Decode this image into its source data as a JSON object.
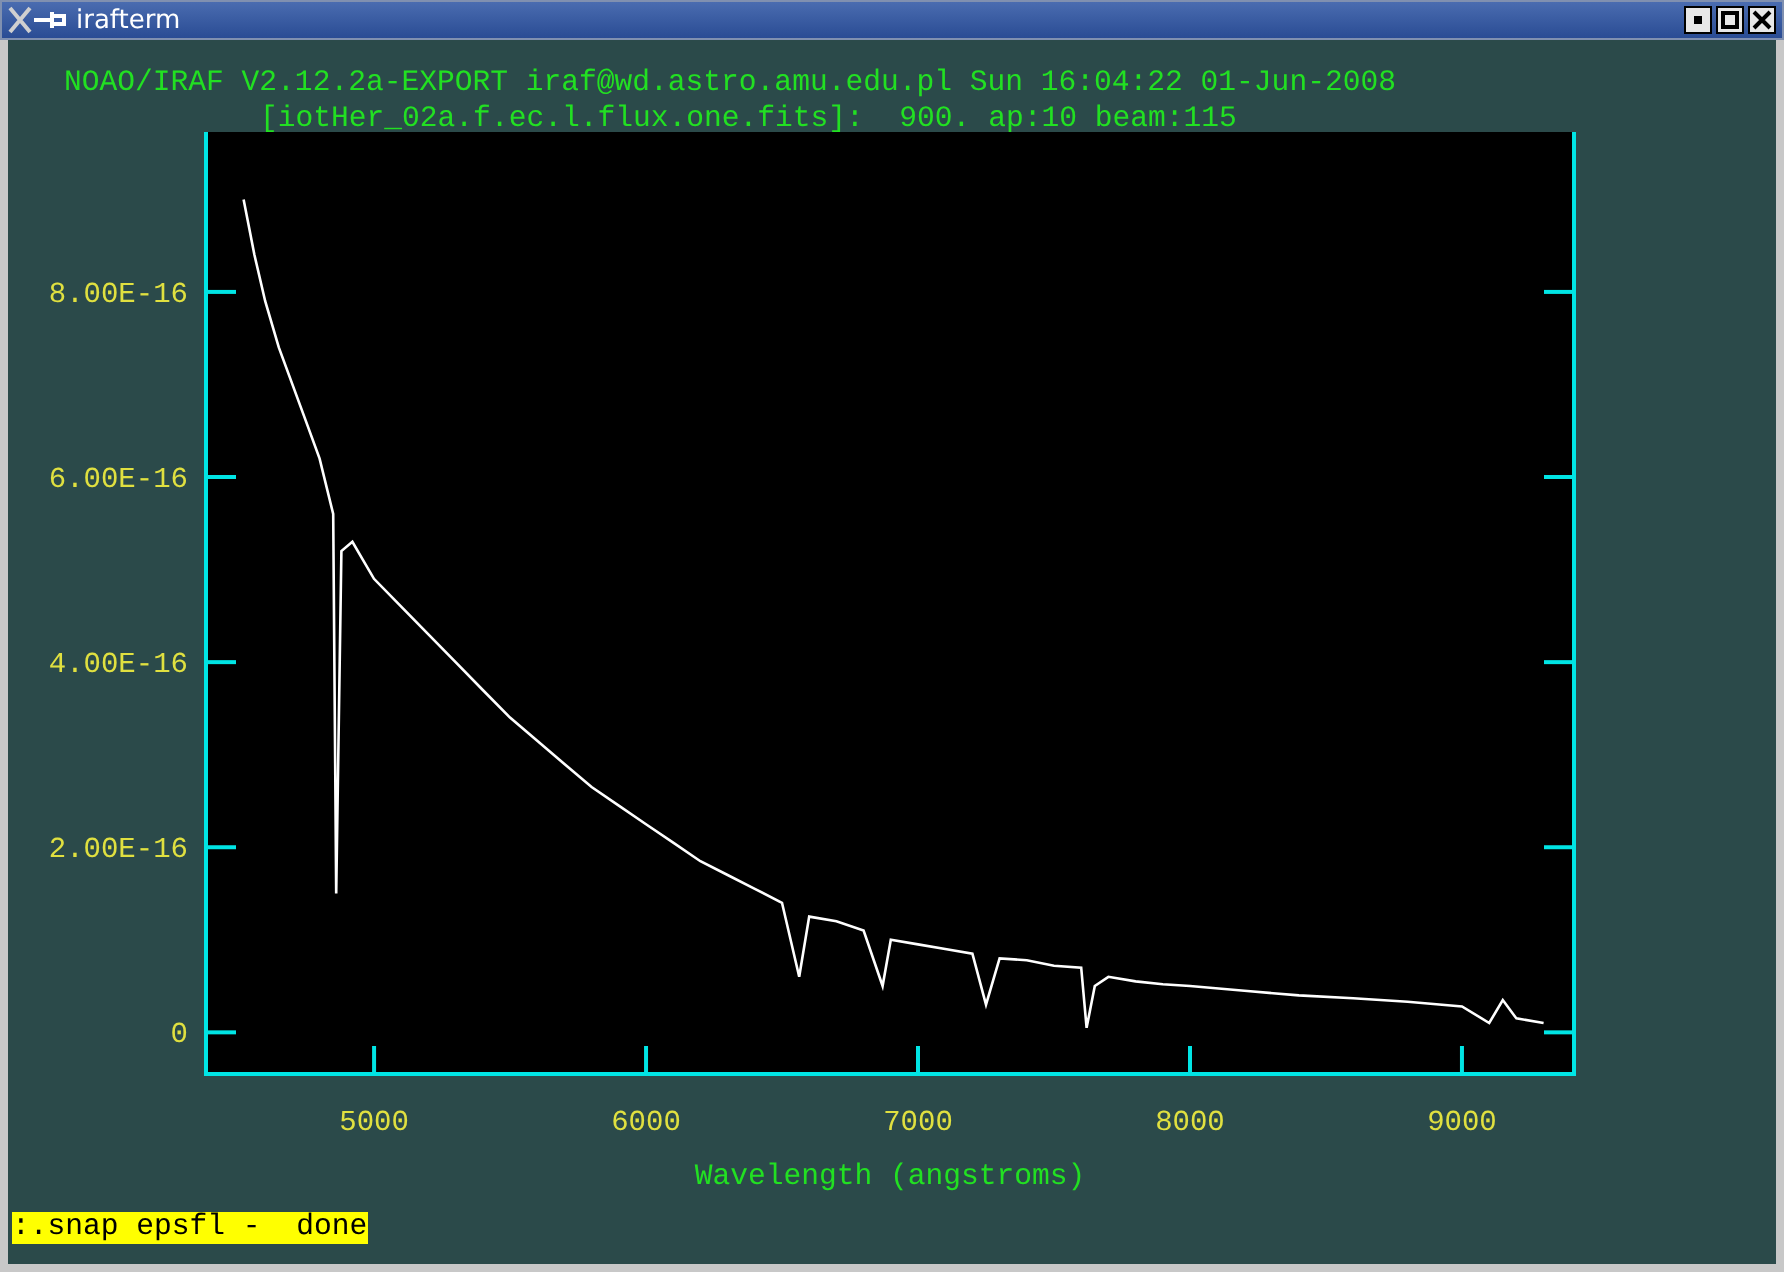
{
  "window": {
    "title": "irafterm"
  },
  "header": {
    "line_1": "NOAO/IRAF V2.12.2a-EXPORT iraf@wd.astro.amu.edu.pl Sun 16:04:22 01-Jun-2008",
    "line_2": "[iotHer_02a.f.ec.l.flux.one.fits]:  900. ap:10 beam:115"
  },
  "plot": {
    "chart_data": {
      "type": "line",
      "xlabel": "Wavelength (angstroms)",
      "x": [
        4520,
        4560,
        4600,
        4650,
        4700,
        4750,
        4800,
        4850,
        4861,
        4880,
        4920,
        4960,
        5000,
        5100,
        5200,
        5300,
        5400,
        5500,
        5600,
        5700,
        5800,
        5900,
        6000,
        6100,
        6200,
        6300,
        6400,
        6500,
        6563,
        6600,
        6700,
        6800,
        6870,
        6900,
        7000,
        7100,
        7200,
        7250,
        7300,
        7400,
        7500,
        7600,
        7620,
        7650,
        7700,
        7800,
        7900,
        8000,
        8200,
        8400,
        8600,
        8800,
        9000,
        9100,
        9150,
        9200,
        9300
      ],
      "series": [
        {
          "color": "#ffffff",
          "values": [
            9e-16,
            8.4e-16,
            7.9e-16,
            7.4e-16,
            7e-16,
            6.6e-16,
            6.2e-16,
            5.6e-16,
            1.5e-16,
            5.2e-16,
            5.3e-16,
            5.1e-16,
            4.9e-16,
            4.6e-16,
            4.3e-16,
            4e-16,
            3.7e-16,
            3.4e-16,
            3.15e-16,
            2.9e-16,
            2.65e-16,
            2.45e-16,
            2.25e-16,
            2.05e-16,
            1.85e-16,
            1.7e-16,
            1.55e-16,
            1.4e-16,
            6e-17,
            1.25e-16,
            1.2e-16,
            1.1e-16,
            5e-17,
            1e-16,
            9.5e-17,
            9e-17,
            8.5e-17,
            3e-17,
            8e-17,
            7.8e-17,
            7.2e-17,
            7e-17,
            5e-18,
            5e-17,
            6e-17,
            5.5e-17,
            5.2e-17,
            5e-17,
            4.5e-17,
            4e-17,
            3.7e-17,
            3.3e-17,
            2.8e-17,
            1e-17,
            3.5e-17,
            1.5e-17,
            1e-17
          ]
        }
      ],
      "xlim": [
        4382,
        9412
      ],
      "ylim": [
        -4.5e-17,
        1.016e-15
      ],
      "xticks": [
        5000,
        6000,
        7000,
        8000,
        9000
      ],
      "yticks": [
        {
          "value": 0,
          "label": "0"
        },
        {
          "value": 2e-16,
          "label": "2.00E-16"
        },
        {
          "value": 4e-16,
          "label": "4.00E-16"
        },
        {
          "value": 6e-16,
          "label": "6.00E-16"
        },
        {
          "value": 8e-16,
          "label": "8.00E-16"
        }
      ]
    }
  },
  "status_line": ":.snap epsfl -  done"
}
